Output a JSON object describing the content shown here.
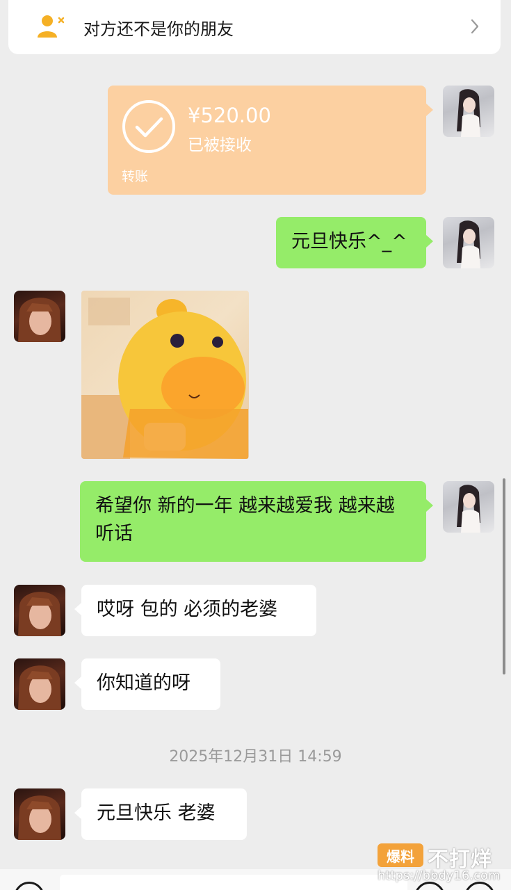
{
  "banner": {
    "text": "对方还不是你的朋友",
    "icon": "add-friend-icon",
    "chevron": "chevron-right-icon"
  },
  "transfer": {
    "amount": "¥520.00",
    "status": "已被接收",
    "label": "转账",
    "color": "#fcd0a1"
  },
  "messages": {
    "m1": "元旦快乐^_^",
    "m2": "希望你 新的一年 越来越爱我 越来越听话",
    "m3": "哎呀 包的 必须的老婆",
    "m4": "你知道的呀",
    "m5": "元旦快乐 老婆"
  },
  "timestamp": "2025年12月31日 14:59",
  "colors": {
    "self_bubble": "#95ec69",
    "other_bubble": "#ffffff",
    "background": "#ededed"
  },
  "watermark": {
    "badge": "爆料",
    "brand": "不打烊",
    "url": "https://bbdy16.com"
  }
}
